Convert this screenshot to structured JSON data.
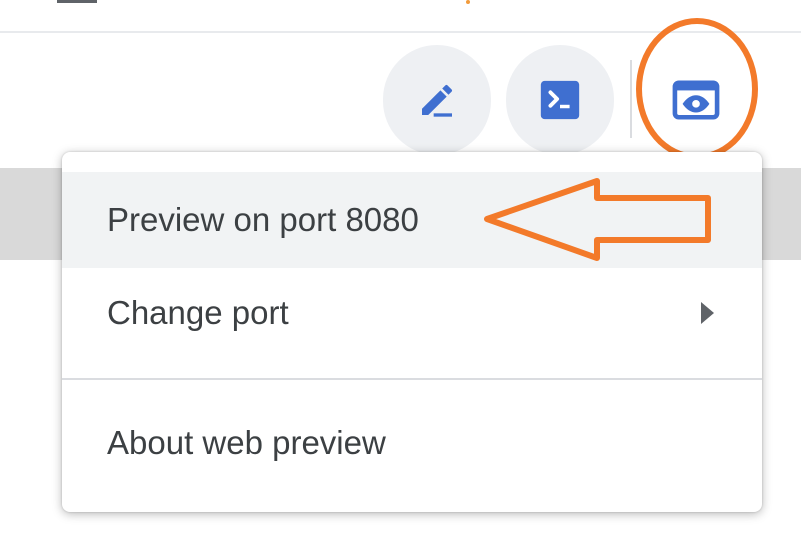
{
  "toolbar": {
    "buttons": [
      {
        "name": "edit",
        "icon": "pencil-icon"
      },
      {
        "name": "cloud-shell",
        "icon": "terminal-icon"
      },
      {
        "name": "web-preview",
        "icon": "web-preview-icon"
      }
    ]
  },
  "menu": {
    "items": [
      {
        "label": "Preview on port 8080"
      },
      {
        "label": "Change port",
        "has_submenu": true
      },
      {
        "label": "About web preview"
      }
    ]
  },
  "colors": {
    "icon_blue": "#3f6fd0",
    "annotation_orange": "#f37a2a",
    "menu_text": "#3c4043",
    "button_bg": "#eef0f3",
    "hover_bg": "#f1f3f4"
  }
}
